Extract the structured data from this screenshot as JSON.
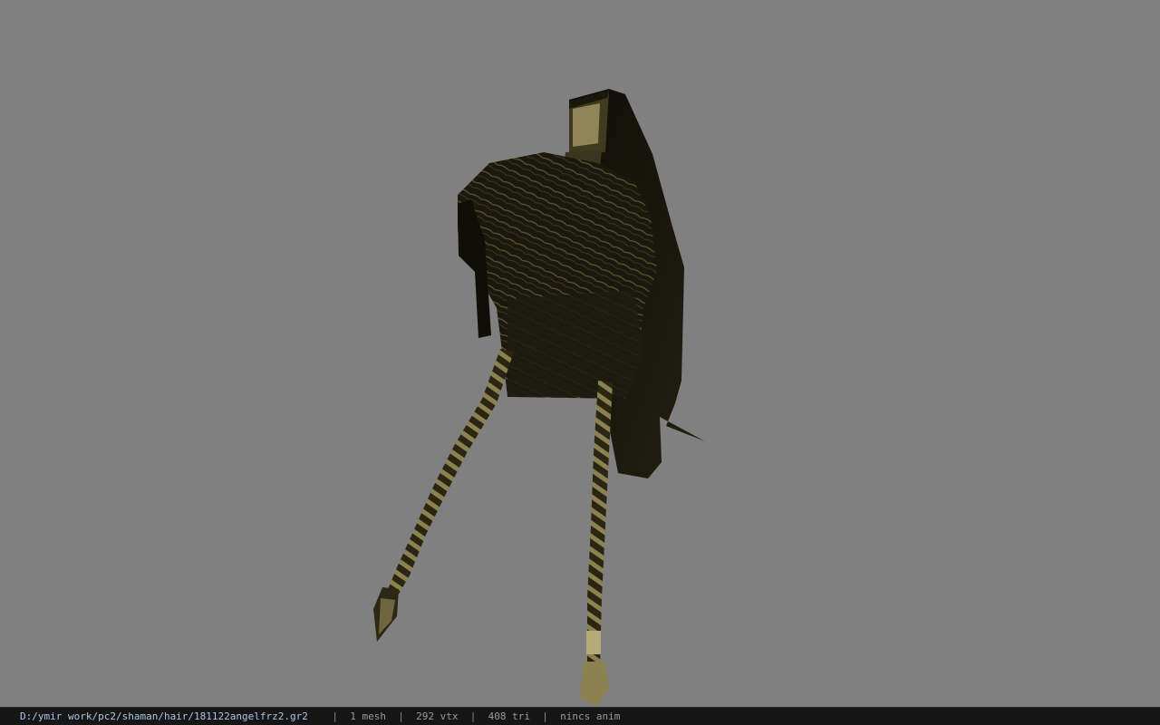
{
  "viewer": {
    "background_color": "#808080",
    "model_colors": {
      "hair_dark": "#17150c",
      "hair_mid": "#2b2815",
      "hair_strand": "#6b6237",
      "braid_light": "#8c8150",
      "band": "#b5aa78"
    },
    "model_icon": "hair-mesh-model"
  },
  "status": {
    "file_path": "D:/ymir work/pc2/shaman/hair/181122angelfrz2.gr2",
    "separator": "|",
    "mesh_count": "1 mesh",
    "vertex_count": "292 vtx",
    "triangle_count": "408 tri",
    "anim_state": "nincs anim"
  }
}
